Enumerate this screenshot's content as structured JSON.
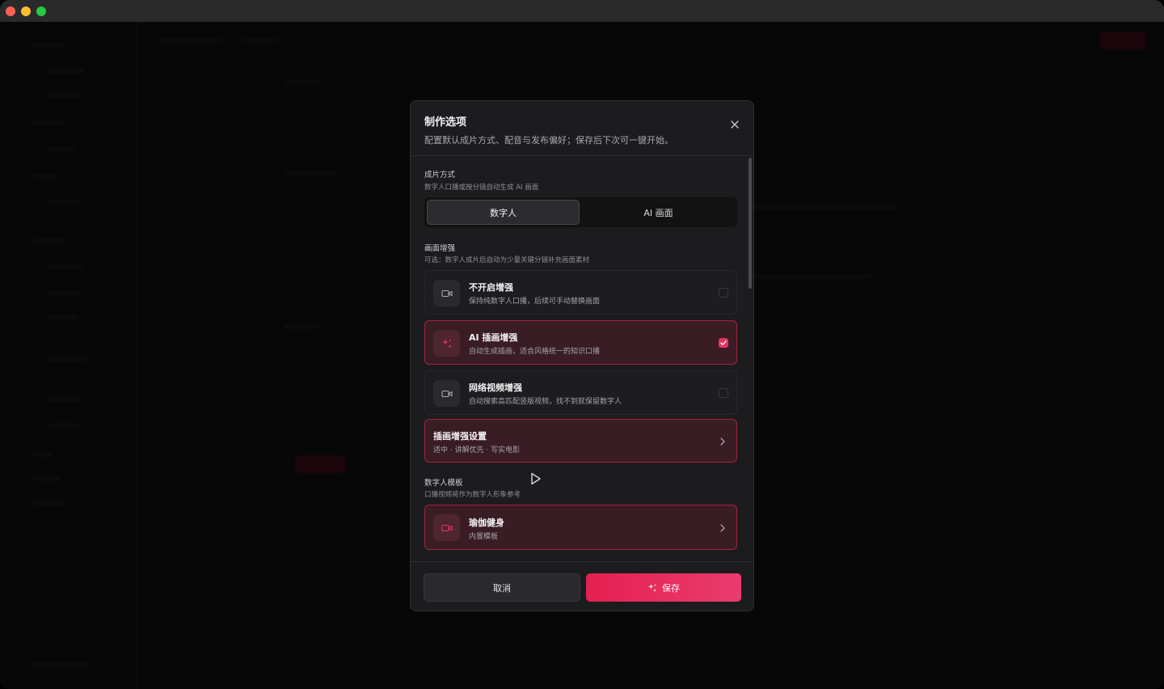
{
  "modal": {
    "title": "制作选项",
    "subtitle": "配置默认成片方式、配音与发布偏好；保存后下次可一键开始。"
  },
  "production_mode": {
    "label": "成片方式",
    "hint": "数字人口播或按分镜自动生成 AI 画面",
    "options": [
      "数字人",
      "AI 画面"
    ],
    "selected": "数字人"
  },
  "enhancement": {
    "label": "画面增强",
    "hint": "可选：数字人成片后自动为少量关键分镜补充画面素材",
    "options": [
      {
        "title": "不开启增强",
        "desc": "保持纯数字人口播，后续可手动替换画面",
        "icon": "video-camera-icon",
        "checked": false
      },
      {
        "title": "AI 插画增强",
        "desc": "自动生成插画，适合风格统一的知识口播",
        "icon": "sparkle-icon",
        "checked": true
      },
      {
        "title": "网络视频增强",
        "desc": "自动搜索高匹配竖版视频，找不到就保留数字人",
        "icon": "video-camera-icon",
        "checked": false
      }
    ]
  },
  "illustration_settings": {
    "title": "插画增强设置",
    "desc": "适中 · 讲解优先 · 写实电影"
  },
  "avatar_template": {
    "label": "数字人模板",
    "hint": "口播视频将作为数字人形象参考",
    "title": "瑜伽健身",
    "desc": "内置模板",
    "icon": "video-camera-icon"
  },
  "footer": {
    "cancel_label": "取消",
    "save_label": "保存"
  },
  "colors": {
    "accent": "#e8315f",
    "selected_bg": "#3a1d24",
    "modal_bg": "#1c1c1e"
  }
}
